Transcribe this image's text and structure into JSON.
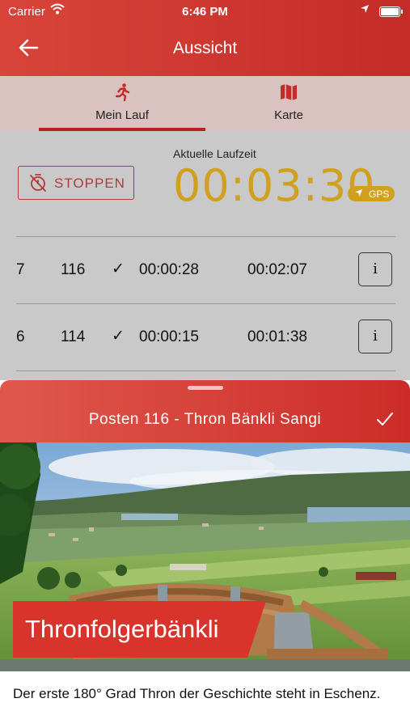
{
  "status_bar": {
    "carrier": "Carrier",
    "time": "6:46 PM"
  },
  "nav": {
    "title": "Aussicht",
    "back_icon": "arrow-left-icon"
  },
  "tabs": [
    {
      "label": "Mein Lauf",
      "icon": "runner-icon",
      "active": true
    },
    {
      "label": "Karte",
      "icon": "map-icon",
      "active": false
    }
  ],
  "run": {
    "stop_label": "STOPPEN",
    "elapsed_label": "Aktuelle Laufzeit",
    "elapsed_time": "00:03:30",
    "gps_label": "GPS",
    "accent_color": "#d0a01e"
  },
  "checkpoints": [
    {
      "index": "7",
      "post": "116",
      "check": "✓",
      "split": "00:00:28",
      "total": "00:02:07",
      "info": "i"
    },
    {
      "index": "6",
      "post": "114",
      "check": "✓",
      "split": "00:00:15",
      "total": "00:01:38",
      "info": "i"
    }
  ],
  "sheet": {
    "title": "Posten 116 - Thron Bänkli Sangi",
    "photo_caption": "Thronfolgerbänkli",
    "description": "Der erste 180° Grad Thron der Geschichte steht in Eschenz."
  },
  "colors": {
    "brand_red": "#cc2c27",
    "tab_bg": "#d9c2bf"
  }
}
